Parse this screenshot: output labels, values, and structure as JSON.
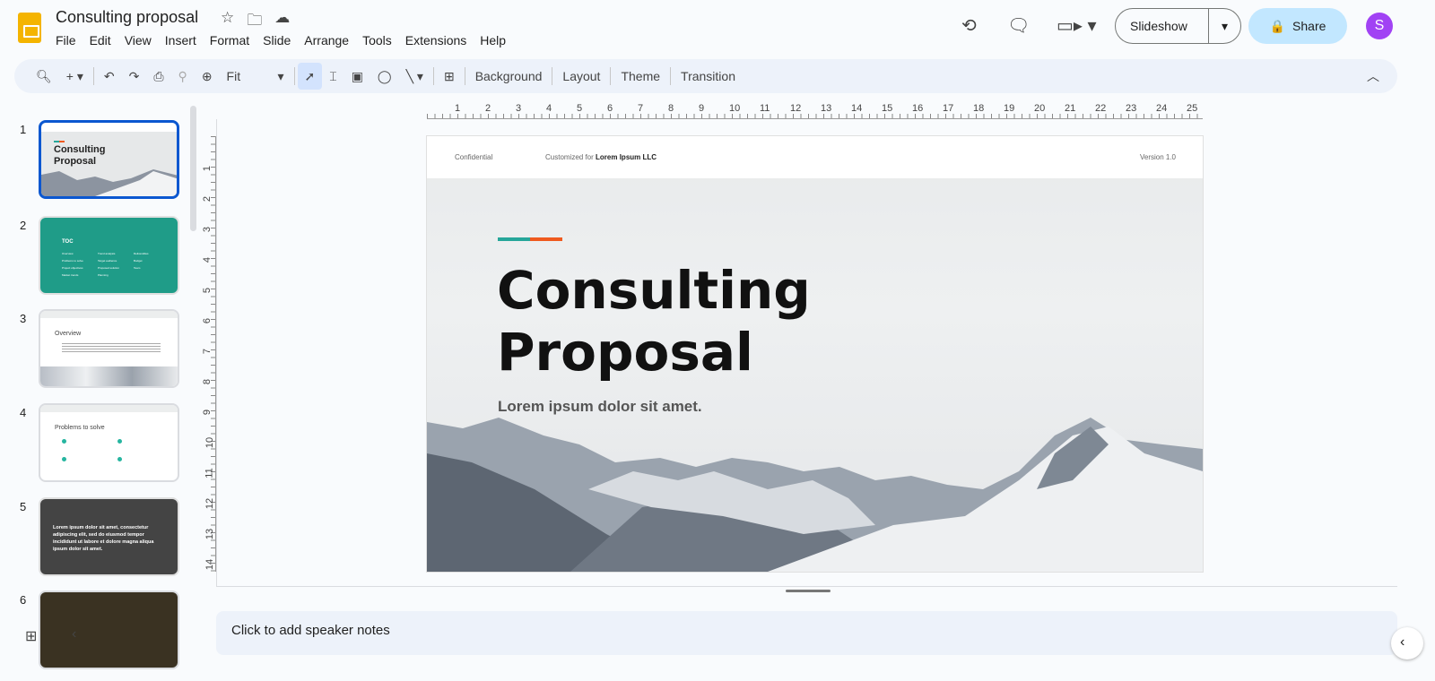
{
  "app": {
    "title": "Consulting proposal",
    "menu": [
      "File",
      "Edit",
      "View",
      "Insert",
      "Format",
      "Slide",
      "Arrange",
      "Tools",
      "Extensions",
      "Help"
    ],
    "slideshow_label": "Slideshow",
    "share_label": "Share",
    "avatar_initial": "S"
  },
  "toolbar": {
    "zoom": "Fit",
    "background": "Background",
    "layout": "Layout",
    "theme": "Theme",
    "transition": "Transition"
  },
  "filmstrip": {
    "slides": [
      {
        "number": "1",
        "title": "Consulting Proposal"
      },
      {
        "number": "2",
        "title": "TOC",
        "items": [
          "Overview",
          "Problems to solve",
          "Project objectives",
          "Market trends",
          "Trend analysis",
          "Target audience",
          "Proposed solution",
          "Planning",
          "Deliverables",
          "Budget",
          "Team"
        ]
      },
      {
        "number": "3",
        "title": "Overview"
      },
      {
        "number": "4",
        "title": "Problems to solve"
      },
      {
        "number": "5",
        "text": "Lorem ipsum dolor sit amet, consectetur adipiscing elit, sed do eiusmod tempor incididunt ut labore et dolore magna aliqua ipsum dolor sit amet."
      },
      {
        "number": "6"
      }
    ]
  },
  "ruler": {
    "h": [
      "1",
      "2",
      "3",
      "4",
      "5",
      "6",
      "7",
      "8",
      "9",
      "10",
      "11",
      "12",
      "13",
      "14",
      "15",
      "16",
      "17",
      "18",
      "19",
      "20",
      "21",
      "22",
      "23",
      "24",
      "25"
    ],
    "v": [
      "1",
      "2",
      "3",
      "4",
      "5",
      "6",
      "7",
      "8",
      "9",
      "10",
      "11",
      "12",
      "13",
      "14"
    ]
  },
  "slide": {
    "confidential": "Confidential",
    "customized_for": "Customized for",
    "client": "Lorem Ipsum LLC",
    "version": "Version 1.0",
    "title_line1": "Consulting",
    "title_line2": "Proposal",
    "subtitle": "Lorem ipsum dolor sit amet.",
    "accent1": "#26a69a",
    "accent2": "#ef5a1f"
  },
  "notes": {
    "placeholder": "Click to add speaker notes"
  }
}
